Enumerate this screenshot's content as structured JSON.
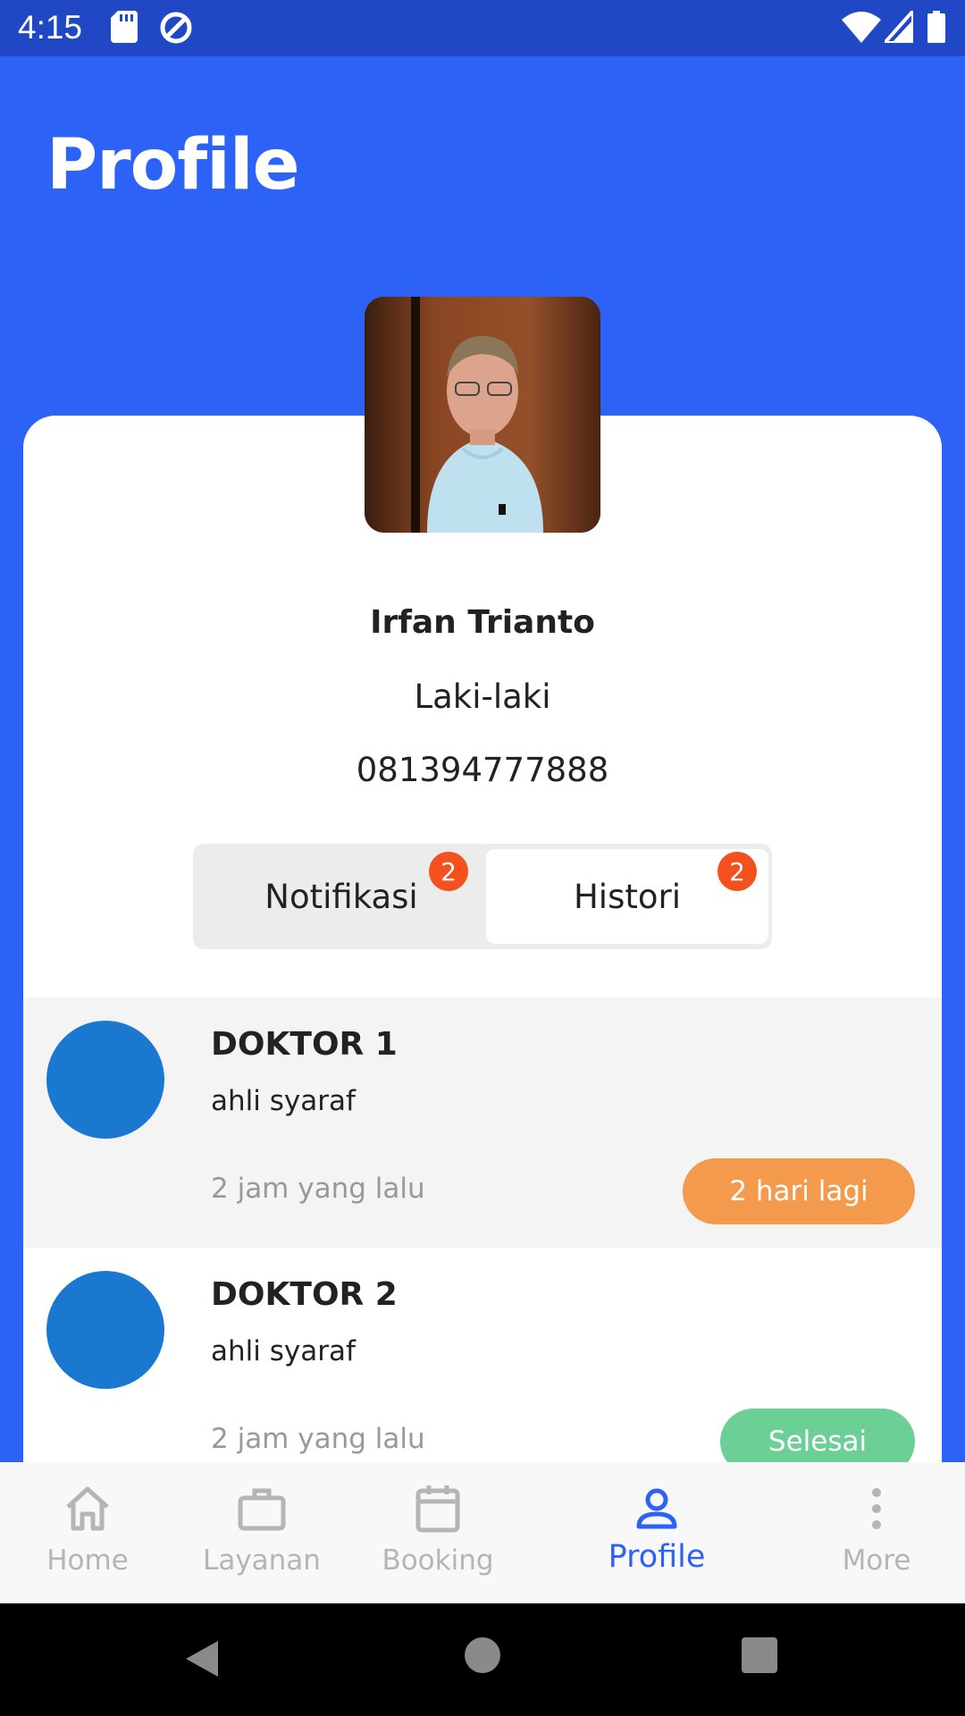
{
  "status_bar": {
    "time": "4:15"
  },
  "header": {
    "title": "Profile"
  },
  "profile": {
    "name": "Irfan Trianto",
    "gender": "Laki-laki",
    "phone": "081394777888"
  },
  "tabs": [
    {
      "label": "Notifikasi",
      "badge": "2",
      "selected": false
    },
    {
      "label": "Histori",
      "badge": "2",
      "selected": true
    }
  ],
  "list": [
    {
      "name": "DOKTOR 1",
      "specialty": "ahli syaraf",
      "time": "2 jam yang lalu",
      "status": "2 hari lagi",
      "status_color": "#f39a4c"
    },
    {
      "name": "DOKTOR 2",
      "specialty": "ahli syaraf",
      "time": "2 jam yang lalu",
      "status": "Selesai",
      "status_color": "#6ccf95"
    }
  ],
  "bottom_nav": [
    {
      "label": "Home",
      "icon": "home-icon",
      "active": false
    },
    {
      "label": "Layanan",
      "icon": "briefcase-icon",
      "active": false
    },
    {
      "label": "Booking",
      "icon": "calendar-icon",
      "active": false
    },
    {
      "label": "Profile",
      "icon": "person-icon",
      "active": true
    },
    {
      "label": "More",
      "icon": "more-vertical-icon",
      "active": false
    }
  ],
  "colors": {
    "primary": "#2d62f6",
    "status_bar": "#2048c4",
    "badge": "#f4511e",
    "doctor_avatar": "#1b78d0"
  }
}
